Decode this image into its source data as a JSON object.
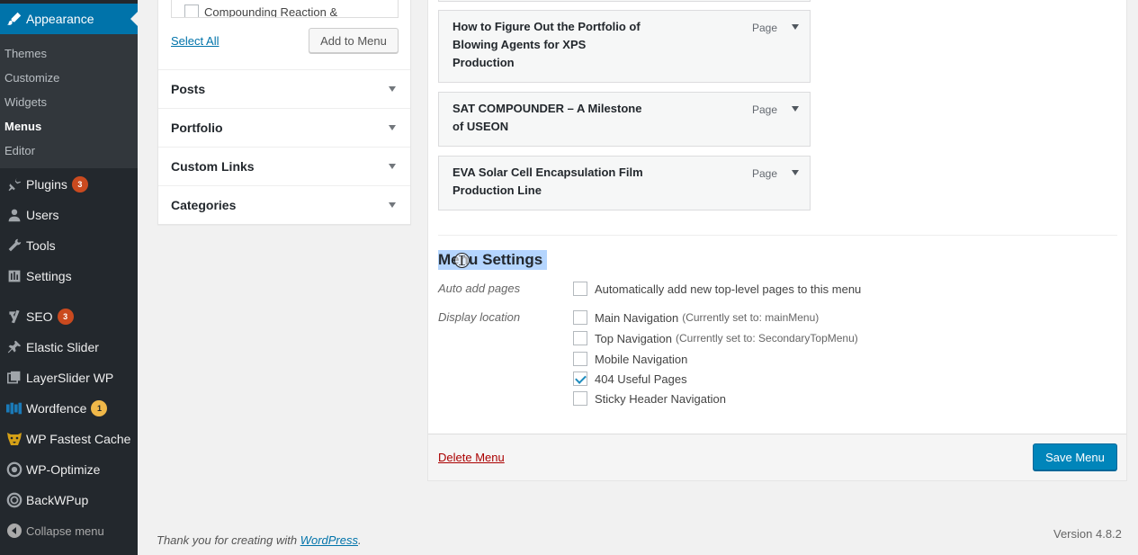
{
  "sidebar": {
    "appearance": "Appearance",
    "submenu": [
      "Themes",
      "Customize",
      "Widgets",
      "Menus",
      "Editor"
    ],
    "plugins": "Plugins",
    "plugins_count": "3",
    "users": "Users",
    "tools": "Tools",
    "settings": "Settings",
    "seo": "SEO",
    "seo_count": "3",
    "elastic_slider": "Elastic Slider",
    "layerslider": "LayerSlider WP",
    "wordfence": "Wordfence",
    "wordfence_count": "1",
    "wp_fastest_cache": "WP Fastest Cache",
    "wp_optimize": "WP-Optimize",
    "backwpup": "BackWPup",
    "collapse": "Collapse menu"
  },
  "add_panel": {
    "partial_item": "Compounding Reaction &",
    "select_all": "Select All",
    "add_to_menu": "Add to Menu",
    "sections": [
      "Posts",
      "Portfolio",
      "Custom Links",
      "Categories"
    ]
  },
  "menu_items": [
    {
      "title": "How to Figure Out the Portfolio of Blowing Agents for XPS Production",
      "type": "Page"
    },
    {
      "title": "SAT COMPOUNDER – A Milestone of USEON",
      "type": "Page"
    },
    {
      "title": "EVA Solar Cell Encapsulation Film Production Line",
      "type": "Page"
    }
  ],
  "menu_settings": {
    "title": "Menu Settings",
    "auto_add_label": "Auto add pages",
    "auto_add_option": "Automatically add new top-level pages to this menu",
    "display_location_label": "Display location",
    "locations": [
      {
        "name": "Main Navigation",
        "note": "(Currently set to: mainMenu)",
        "checked": false
      },
      {
        "name": "Top Navigation",
        "note": "(Currently set to: SecondaryTopMenu)",
        "checked": false
      },
      {
        "name": "Mobile Navigation",
        "note": "",
        "checked": false
      },
      {
        "name": "404 Useful Pages",
        "note": "",
        "checked": true
      },
      {
        "name": "Sticky Header Navigation",
        "note": "",
        "checked": false
      }
    ],
    "delete_menu": "Delete Menu",
    "save_menu": "Save Menu"
  },
  "footer": {
    "thanks_prefix": "Thank you for creating with",
    "wordpress_link": "WordPress",
    "thanks_suffix": ".",
    "version": "Version 4.8.2"
  },
  "colors": {
    "sidebar_bg": "#23282d",
    "submenu_bg": "#32373c",
    "accent": "#0073aa",
    "primary_button": "#0085ba",
    "count_badge": "#ca4a1f",
    "count_badge_yellow": "#f0b849",
    "delete_link": "#a00000",
    "selection": "#b4d5fe"
  },
  "icons": [
    "paintbrush-icon",
    "plugin-icon",
    "users-icon",
    "tools-icon",
    "settings-icon",
    "yoast-icon",
    "pin-icon",
    "layers-icon",
    "wordfence-icon",
    "cheetah-icon",
    "optimize-icon",
    "backup-icon",
    "collapse-icon",
    "cursor-icon"
  ]
}
